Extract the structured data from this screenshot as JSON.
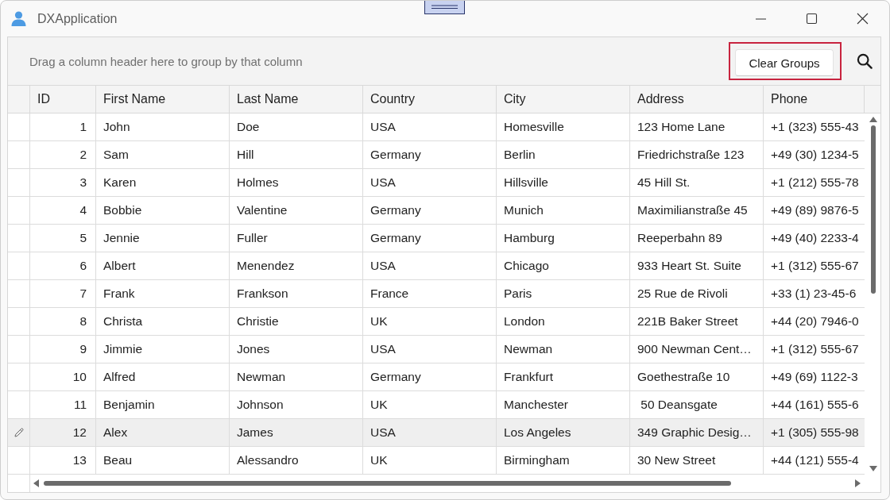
{
  "window": {
    "title": "DXApplication"
  },
  "group_panel": {
    "hint": "Drag a column header here to group by that column",
    "clear_button": {
      "label": "Clear Groups",
      "highlighted": true
    }
  },
  "grid": {
    "columns": [
      "ID",
      "First Name",
      "Last Name",
      "Country",
      "City",
      "Address",
      "Phone"
    ],
    "rows": [
      {
        "selected": false,
        "cells": [
          "1",
          "John",
          "Doe",
          "USA",
          "Homesville",
          "123 Home Lane",
          "+1 (323) 555-43"
        ]
      },
      {
        "selected": false,
        "cells": [
          "2",
          "Sam",
          "Hill",
          "Germany",
          "Berlin",
          "Friedrichstraße 123",
          "+49 (30) 1234-5"
        ]
      },
      {
        "selected": false,
        "cells": [
          "3",
          "Karen",
          "Holmes",
          "USA",
          "Hillsville",
          "45 Hill St.",
          "+1 (212) 555-78"
        ]
      },
      {
        "selected": false,
        "cells": [
          "4",
          "Bobbie",
          "Valentine",
          "Germany",
          "Munich",
          "Maximilianstraße 45",
          "+49 (89) 9876-5"
        ]
      },
      {
        "selected": false,
        "cells": [
          "5",
          "Jennie",
          "Fuller",
          "Germany",
          "Hamburg",
          "Reeperbahn 89",
          "+49 (40) 2233-4"
        ]
      },
      {
        "selected": false,
        "cells": [
          "6",
          "Albert",
          "Menendez",
          "USA",
          "Chicago",
          "933 Heart St. Suite",
          "+1 (312) 555-67"
        ]
      },
      {
        "selected": false,
        "cells": [
          "7",
          "Frank",
          "Frankson",
          "France",
          "Paris",
          "25 Rue de Rivoli",
          "+33 (1) 23-45-6"
        ]
      },
      {
        "selected": false,
        "cells": [
          "8",
          "Christa",
          "Christie",
          "UK",
          "London",
          "221B Baker Street",
          "+44 (20) 7946-0"
        ]
      },
      {
        "selected": false,
        "cells": [
          "9",
          "Jimmie",
          "Jones",
          "USA",
          "Newman",
          "900 Newman Cent…",
          "+1 (312) 555-67"
        ]
      },
      {
        "selected": false,
        "cells": [
          "10",
          "Alfred",
          "Newman",
          "Germany",
          "Frankfurt",
          "Goethestraße 10",
          "+49 (69) 1122-3"
        ]
      },
      {
        "selected": false,
        "cells": [
          "11",
          "Benjamin",
          "Johnson",
          "UK",
          "Manchester",
          " 50 Deansgate",
          "+44 (161) 555-6"
        ]
      },
      {
        "selected": true,
        "cells": [
          "12",
          "Alex",
          "James",
          "USA",
          "Los Angeles",
          "349 Graphic Desig…",
          "+1 (305) 555-98"
        ]
      },
      {
        "selected": false,
        "cells": [
          "13",
          "Beau",
          "Alessandro",
          "UK",
          "Birmingham",
          "30 New Street",
          "+44 (121) 555-4"
        ]
      }
    ]
  }
}
